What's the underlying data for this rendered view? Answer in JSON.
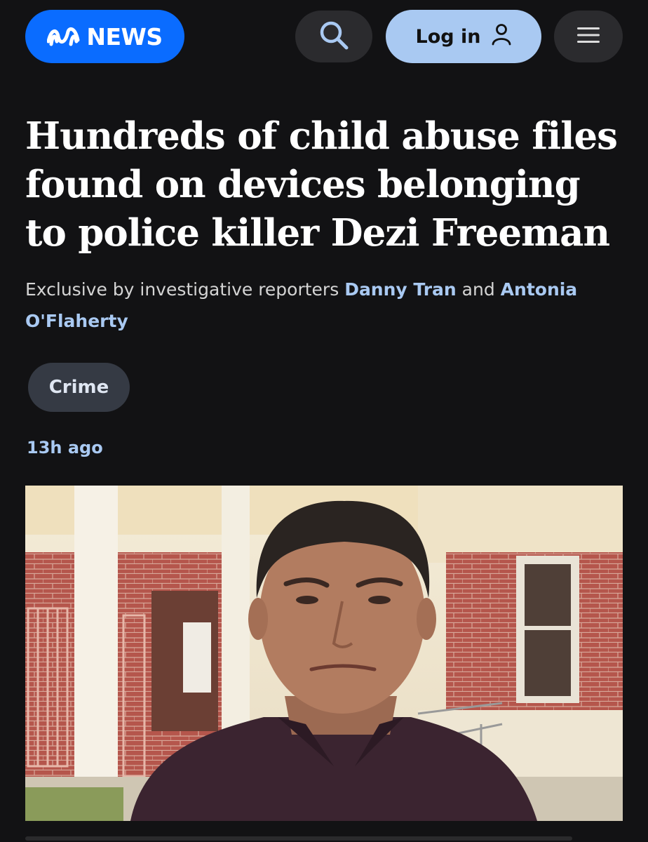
{
  "header": {
    "logo_text": "NEWS",
    "logo_color": "#0a6cff",
    "search_icon": "search-icon",
    "login_label": "Log in",
    "login_icon": "user-icon",
    "menu_icon": "hamburger-menu-icon"
  },
  "article": {
    "headline": "Hundreds of child abuse files found on devices belonging to police killer Dezi Freeman",
    "byline_prefix": "Exclusive by investigative reporters",
    "author_1": "Danny Tran",
    "byline_joiner": "and",
    "author_2": "Antonia O'Flaherty",
    "tag": "Crime",
    "published": "13h ago"
  },
  "colors": {
    "background": "#121214",
    "accent_light": "#a9c9f2",
    "tag_background": "#353a44"
  }
}
